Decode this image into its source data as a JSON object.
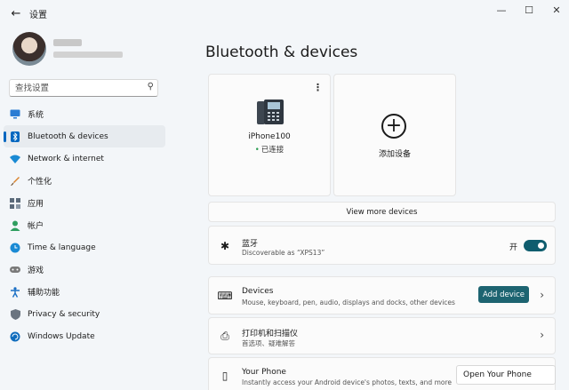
{
  "window": {
    "title": "设置",
    "back": "←",
    "minimize": "—",
    "maximize": "☐",
    "close": "✕"
  },
  "sidebar": {
    "search_placeholder": "查找设置",
    "search_icon": "⚲",
    "items": [
      {
        "label": "系统",
        "icon": "monitor-icon",
        "color": "#2b7cd3"
      },
      {
        "label": "Bluetooth & devices",
        "icon": "bluetooth-icon",
        "color": "#0067c0"
      },
      {
        "label": "Network & internet",
        "icon": "wifi-icon",
        "color": "#1a8ad4"
      },
      {
        "label": "个性化",
        "icon": "brush-icon",
        "color": "#d9822b"
      },
      {
        "label": "应用",
        "icon": "apps-icon",
        "color": "#5b6a7a"
      },
      {
        "label": "帐户",
        "icon": "person-icon",
        "color": "#2f9e5f"
      },
      {
        "label": "Time & language",
        "icon": "globe-clock-icon",
        "color": "#1a8ad4"
      },
      {
        "label": "游戏",
        "icon": "gamepad-icon",
        "color": "#6a6a6a"
      },
      {
        "label": "辅助功能",
        "icon": "accessibility-icon",
        "color": "#1a6fc4"
      },
      {
        "label": "Privacy & security",
        "icon": "shield-icon",
        "color": "#6a7480"
      },
      {
        "label": "Windows Update",
        "icon": "update-icon",
        "color": "#0f6cbd"
      }
    ]
  },
  "main": {
    "title": "Bluetooth & devices",
    "device": {
      "name": "iPhone100",
      "dot": "•",
      "status": "已连接",
      "more": "⋮"
    },
    "add_device_card": {
      "label": "添加设备",
      "plus": "+"
    },
    "view_more": "View more devices",
    "bluetooth": {
      "icon": "✱",
      "title": "蓝牙",
      "subtitle": "Discoverable as “XPS13”",
      "toggle_label": "开"
    },
    "devices_row": {
      "icon": "⌨",
      "title": "Devices",
      "subtitle": "Mouse, keyboard, pen, audio, displays and docks, other devices",
      "button": "Add device",
      "chevron": "›"
    },
    "printers_row": {
      "icon": "⎙",
      "title": "打印机和扫描仪",
      "subtitle": "首选项、疑难解答",
      "chevron": "›"
    },
    "phone_row": {
      "icon": "▯",
      "title": "Your Phone",
      "subtitle": "Instantly access your Android device's photos, texts, and more",
      "button": "Open Your Phone"
    }
  }
}
